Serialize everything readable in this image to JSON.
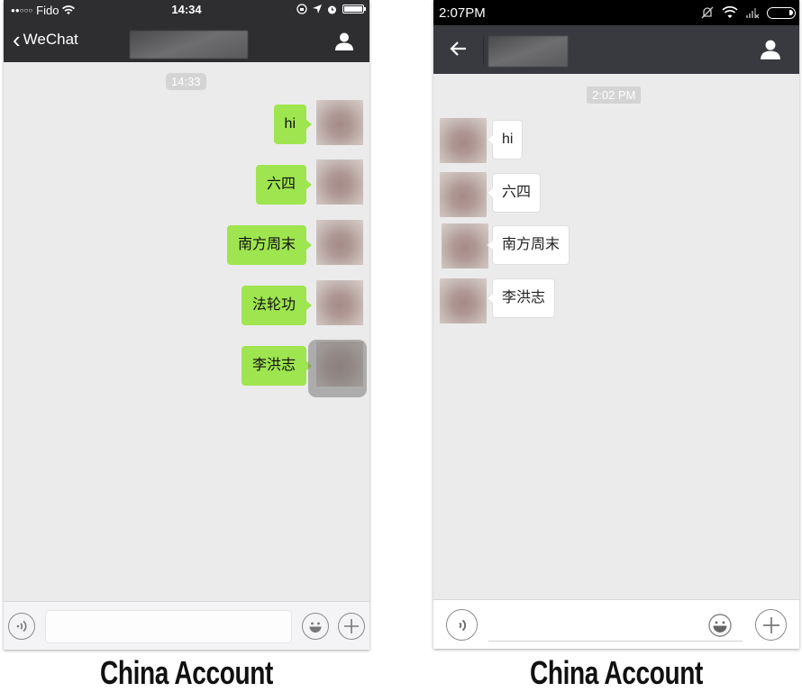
{
  "ios": {
    "status_bar": {
      "signal_dots": "●●○○○",
      "carrier": "Fido",
      "time": "14:34"
    },
    "nav": {
      "back_label": "WeChat"
    },
    "timestamp": "14:33",
    "messages": [
      {
        "text": "hi",
        "direction": "outgoing"
      },
      {
        "text": "六四",
        "direction": "outgoing"
      },
      {
        "text": "南方周末",
        "direction": "outgoing"
      },
      {
        "text": "法轮功",
        "direction": "outgoing"
      },
      {
        "text": "李洪志",
        "direction": "outgoing"
      }
    ],
    "input": {
      "value": "",
      "placeholder": ""
    },
    "bubble_color": "#9ee54f"
  },
  "android": {
    "status_bar": {
      "time": "2:07PM"
    },
    "timestamp": "2:02 PM",
    "messages": [
      {
        "text": "hi",
        "direction": "incoming"
      },
      {
        "text": "六四",
        "direction": "incoming"
      },
      {
        "text": "南方周末",
        "direction": "incoming"
      },
      {
        "text": "李洪志",
        "direction": "incoming"
      }
    ],
    "input": {
      "value": "",
      "placeholder": ""
    },
    "bubble_color": "#ffffff"
  },
  "captions": {
    "left": "China Account",
    "right": "China Account"
  }
}
